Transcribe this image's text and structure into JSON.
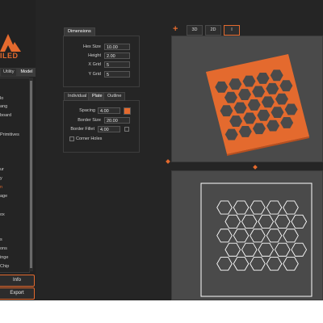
{
  "sidebar": {
    "logo_text": "ILED",
    "tabs": [
      "Utility",
      "Model"
    ],
    "items": [
      {
        "label": "lo",
        "highlight": false
      },
      {
        "label": "ang",
        "highlight": false
      },
      {
        "label": "board",
        "highlight": false
      },
      {
        "label": "Primitives",
        "highlight": false
      },
      {
        "label": "ur",
        "highlight": false
      },
      {
        "label": "y",
        "highlight": false
      },
      {
        "label": "n",
        "highlight": true
      },
      {
        "label": "age",
        "highlight": false
      },
      {
        "label": "ox",
        "highlight": false
      },
      {
        "label": "s",
        "highlight": false
      },
      {
        "label": "ons",
        "highlight": false
      },
      {
        "label": "inge",
        "highlight": false
      },
      {
        "label": "Chip",
        "highlight": false
      }
    ],
    "info_button": "Info",
    "export_button": "Export"
  },
  "dimensions": {
    "title": "Dimensions",
    "fields": [
      {
        "label": "Hex Size",
        "value": "10.00"
      },
      {
        "label": "Height",
        "value": "2.00"
      },
      {
        "label": "X Grid",
        "value": "5"
      },
      {
        "label": "Y Grid",
        "value": "5"
      }
    ]
  },
  "plate_panel": {
    "tabs": [
      "Individual",
      "Plate",
      "Outline"
    ],
    "active_tab": "Plate",
    "fields": [
      {
        "label": "Spacing",
        "value": "4.00"
      },
      {
        "label": "Border Size",
        "value": "20.00"
      },
      {
        "label": "Border Fillet",
        "value": "4.00"
      }
    ],
    "color_swatch": "#e46a2e",
    "corner_holes_label": "Corner Holes"
  },
  "view_controls": {
    "buttons": [
      "3D",
      "2D",
      "I"
    ],
    "active": "I",
    "add_icon": "plus-icon"
  },
  "colors": {
    "accent": "#e46a2e",
    "viewport_bg": "#4a4a4a",
    "outline": "#ffffff"
  }
}
